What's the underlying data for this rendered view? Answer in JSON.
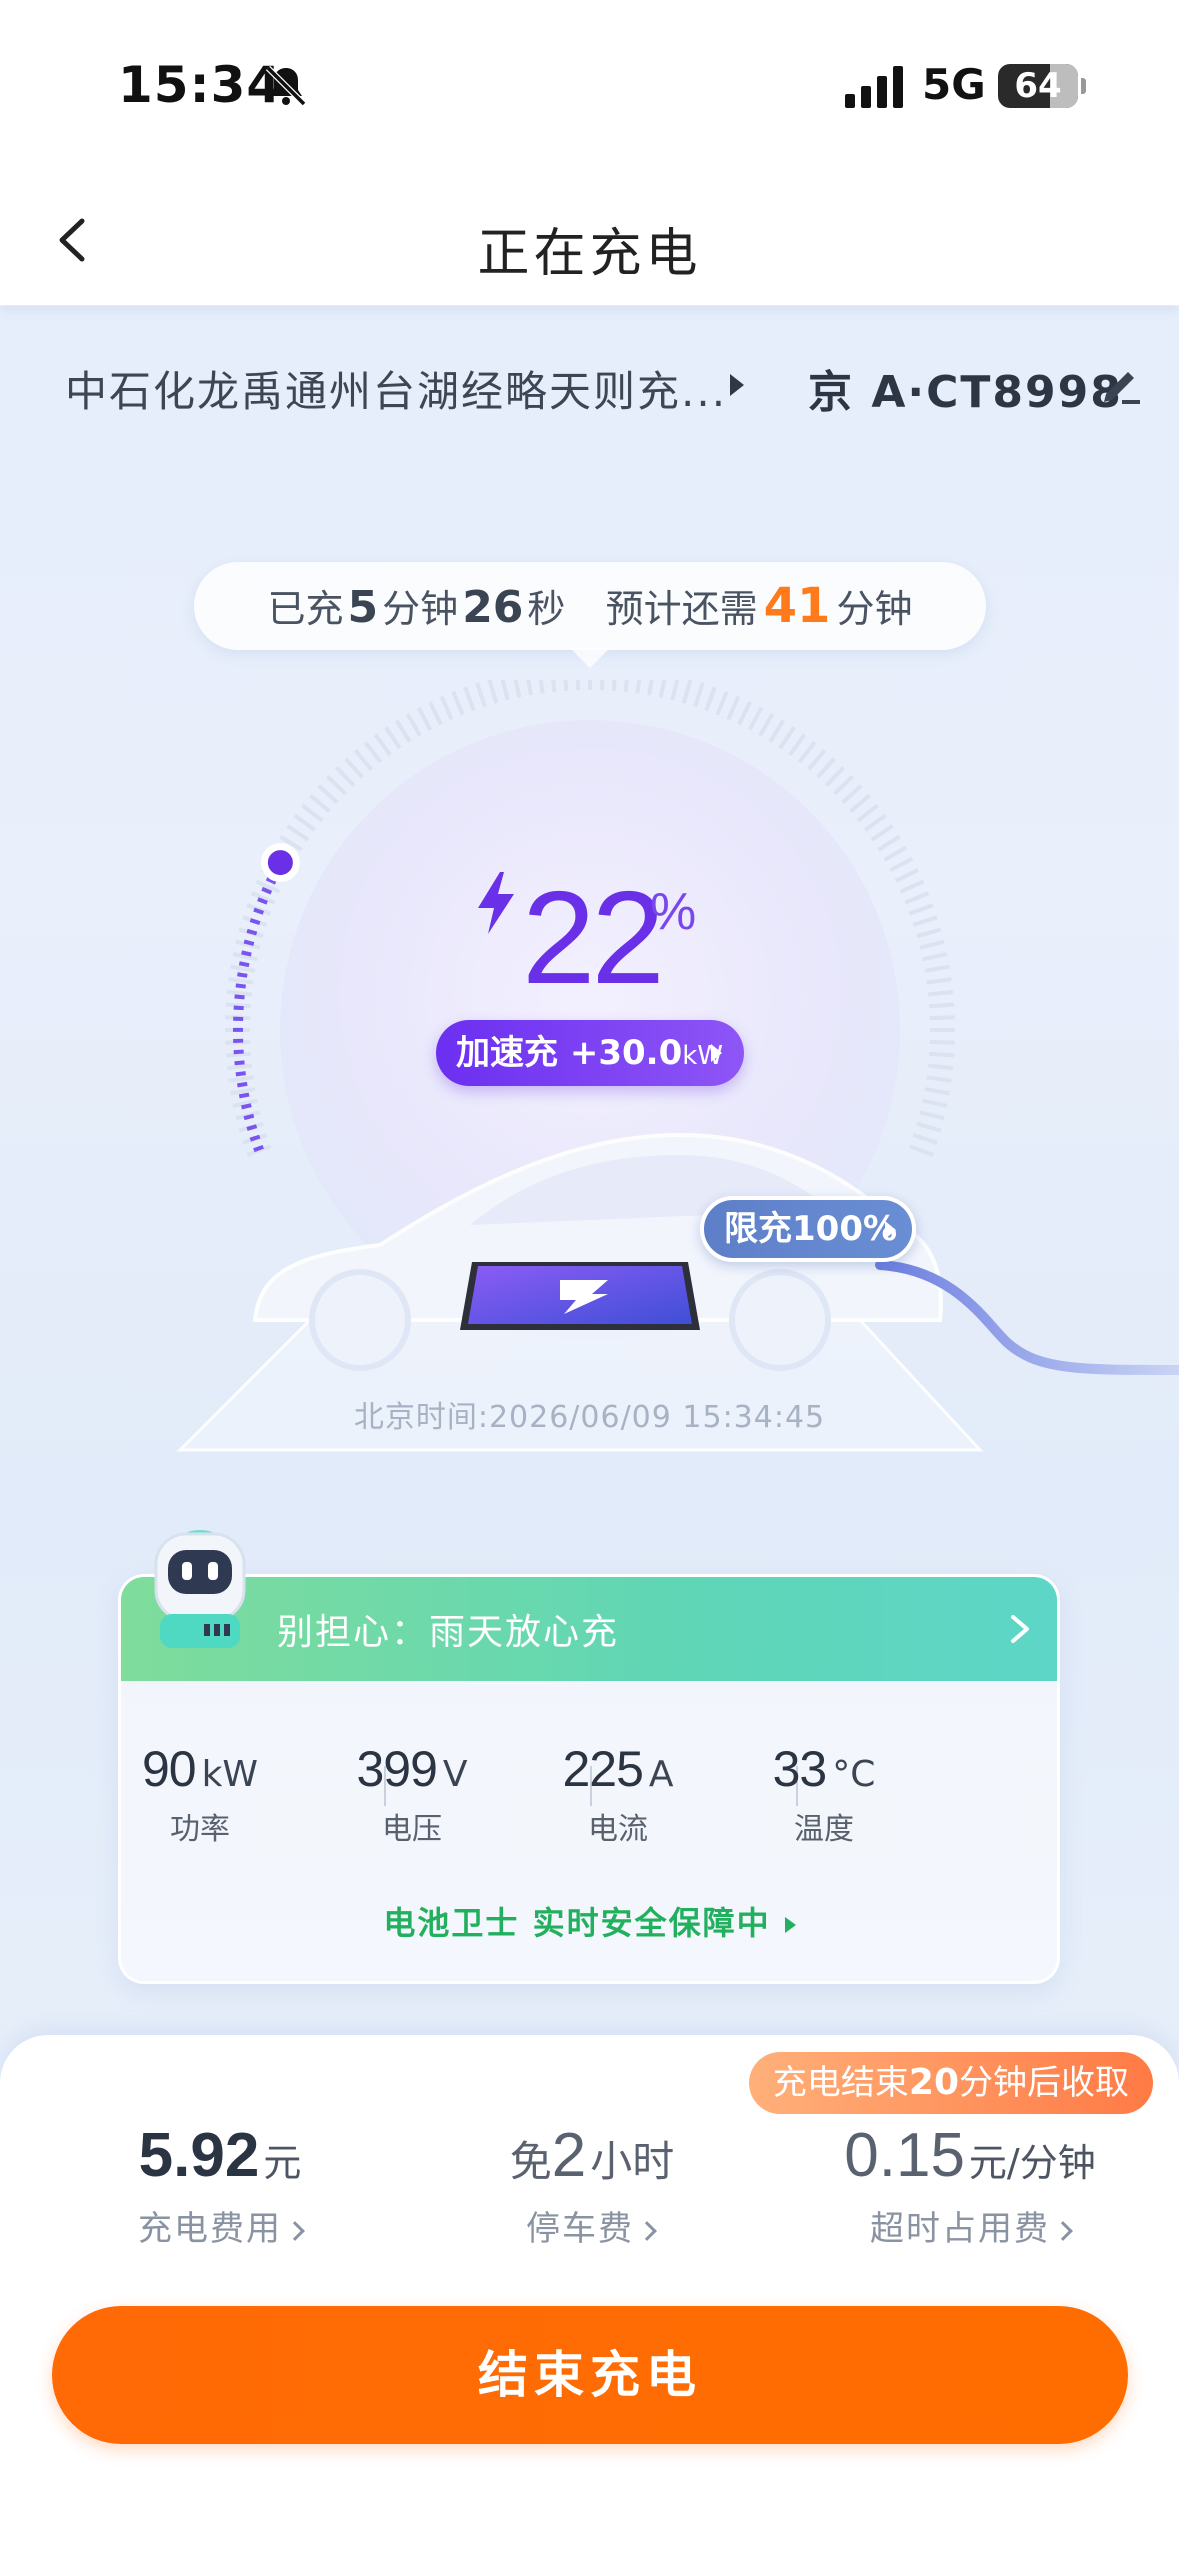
{
  "status": {
    "time": "15:34",
    "network": "5G",
    "battery": "64"
  },
  "nav": {
    "title": "正在充电"
  },
  "station": {
    "name": "中石化龙禹通州台湖经略天则充...",
    "plate": "京 A·CT8998"
  },
  "timer": {
    "prefix": "已充",
    "charged_min": "5",
    "min_unit": "分钟",
    "charged_sec": "26",
    "sec_unit": "秒",
    "remain_prefix": "预计还需",
    "remain_min": "41",
    "remain_unit": "分钟"
  },
  "gauge": {
    "percent": "22",
    "percent_sign": "%",
    "level": 0.22,
    "boost_label": "加速充",
    "boost_value": "+30.0",
    "boost_unit": "kW",
    "limit_label": "限充100%",
    "beijing_time": "北京时间:2026/06/09 15:34:45"
  },
  "safety": {
    "banner": "别担心：雨天放心充",
    "metrics": [
      {
        "value": "90",
        "unit": "kW",
        "label": "功率"
      },
      {
        "value": "399",
        "unit": "V",
        "label": "电压"
      },
      {
        "value": "225",
        "unit": "A",
        "label": "电流"
      },
      {
        "value": "33",
        "unit": "°C",
        "label": "温度"
      }
    ],
    "guard_text": "电池卫士 实时安全保障中"
  },
  "sheet": {
    "pickup_prefix": "充电结束",
    "pickup_num": "20",
    "pickup_suffix": "分钟后收取",
    "fees": [
      {
        "prefix": "",
        "value": "5.92",
        "unit": "元",
        "label": "充电费用"
      },
      {
        "prefix": "免",
        "value": "2",
        "unit": "小时",
        "label": "停车费"
      },
      {
        "prefix": "",
        "value": "0.15",
        "unit": "元/分钟",
        "label": "超时占用费"
      }
    ],
    "end_button": "结束充电"
  },
  "colors": {
    "accent_purple": "#6a30e8",
    "end_orange": "#ff6a06",
    "safe_green": "#23b05e",
    "remain_orange": "#ff7a1a"
  },
  "icons": [
    "bell-off-icon",
    "signal-icon",
    "battery-icon",
    "back-chevron-icon",
    "triangle-right-icon",
    "edit-pencil-icon",
    "lightning-icon",
    "robot-mascot-icon",
    "chevron-right-icon"
  ]
}
